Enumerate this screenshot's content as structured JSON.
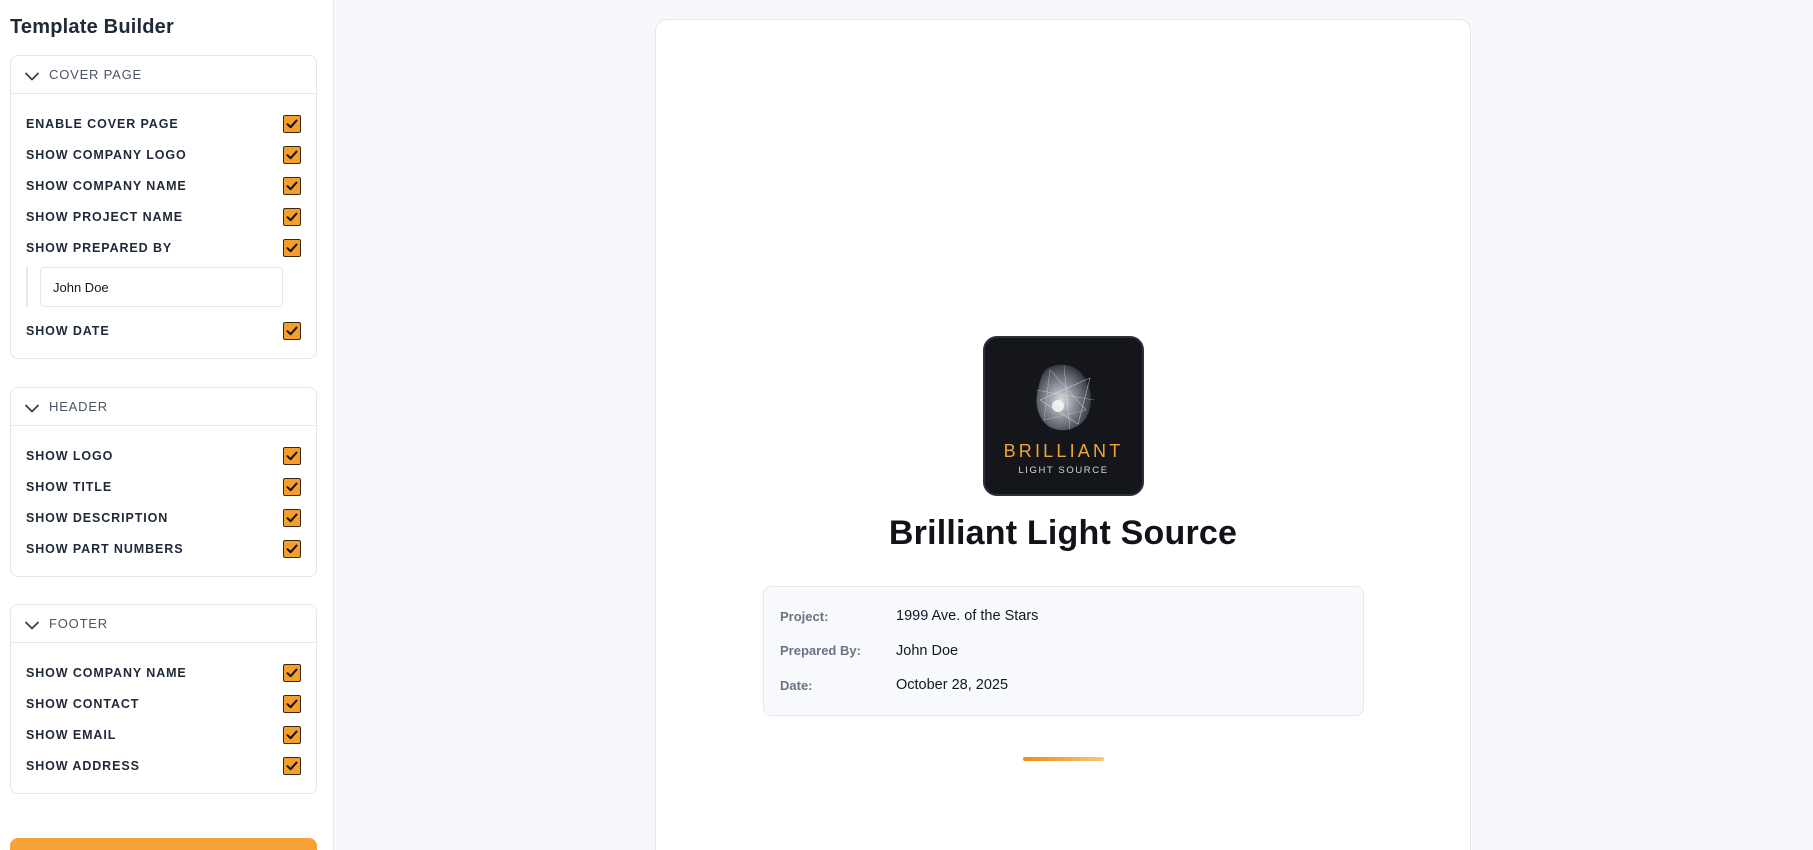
{
  "sidebar": {
    "title": "Template Builder",
    "sections": [
      {
        "title": "COVER PAGE",
        "items": [
          {
            "label": "ENABLE COVER PAGE",
            "checked": true
          },
          {
            "label": "SHOW COMPANY LOGO",
            "checked": true
          },
          {
            "label": "SHOW COMPANY NAME",
            "checked": true
          },
          {
            "label": "SHOW PROJECT NAME",
            "checked": true
          },
          {
            "label": "SHOW PREPARED BY",
            "checked": true
          },
          {
            "label": "SHOW DATE",
            "checked": true
          }
        ],
        "prepared_by_value": "John Doe"
      },
      {
        "title": "HEADER",
        "items": [
          {
            "label": "SHOW LOGO",
            "checked": true
          },
          {
            "label": "SHOW TITLE",
            "checked": true
          },
          {
            "label": "SHOW DESCRIPTION",
            "checked": true
          },
          {
            "label": "SHOW PART NUMBERS",
            "checked": true
          }
        ]
      },
      {
        "title": "FOOTER",
        "items": [
          {
            "label": "SHOW COMPANY NAME",
            "checked": true
          },
          {
            "label": "SHOW CONTACT",
            "checked": true
          },
          {
            "label": "SHOW EMAIL",
            "checked": true
          },
          {
            "label": "SHOW ADDRESS",
            "checked": true
          }
        ]
      }
    ]
  },
  "preview": {
    "logo_word": "BRILLIANT",
    "logo_sub": "LIGHT SOURCE",
    "company_name": "Brilliant Light Source",
    "info": [
      {
        "label": "Project:",
        "value": "1999 Ave. of the Stars"
      },
      {
        "label": "Prepared By:",
        "value": "John Doe"
      },
      {
        "label": "Date:",
        "value": "October 28, 2025"
      }
    ]
  },
  "colors": {
    "accent": "#f59e2b",
    "page_background": "#f7f8fb",
    "logo_background": "#14161b"
  },
  "icons": {
    "section_toggle": "chevron-down-icon",
    "checkbox": "check-icon"
  }
}
